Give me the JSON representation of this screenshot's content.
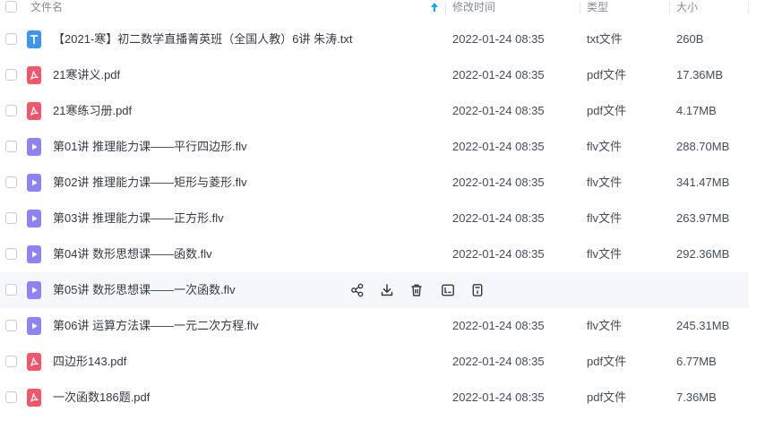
{
  "header": {
    "name_label": "文件名",
    "date_label": "修改时间",
    "type_label": "类型",
    "size_label": "大小"
  },
  "files": [
    {
      "name": "【2021-寒】初二数学直播菁英班（全国人教）6讲 朱涛.txt",
      "icon": "txt-file-icon",
      "date": "2022-01-24 08:35",
      "type": "txt文件",
      "size": "260B"
    },
    {
      "name": "21寒讲义.pdf",
      "icon": "pdf-file-icon",
      "date": "2022-01-24 08:35",
      "type": "pdf文件",
      "size": "17.36MB"
    },
    {
      "name": "21寒练习册.pdf",
      "icon": "pdf-file-icon",
      "date": "2022-01-24 08:35",
      "type": "pdf文件",
      "size": "4.17MB"
    },
    {
      "name": "第01讲 推理能力课——平行四边形.flv",
      "icon": "video-file-icon",
      "date": "2022-01-24 08:35",
      "type": "flv文件",
      "size": "288.70MB"
    },
    {
      "name": "第02讲 推理能力课——矩形与菱形.flv",
      "icon": "video-file-icon",
      "date": "2022-01-24 08:35",
      "type": "flv文件",
      "size": "341.47MB"
    },
    {
      "name": "第03讲 推理能力课——正方形.flv",
      "icon": "video-file-icon",
      "date": "2022-01-24 08:35",
      "type": "flv文件",
      "size": "263.97MB"
    },
    {
      "name": "第04讲 数形思想课——函数.flv",
      "icon": "video-file-icon",
      "date": "2022-01-24 08:35",
      "type": "flv文件",
      "size": "292.36MB"
    },
    {
      "name": "第05讲 数形思想课——一次函数.flv",
      "icon": "video-file-icon",
      "date": "",
      "type": "",
      "size": "",
      "hover": true
    },
    {
      "name": "第06讲 运算方法课——一元二次方程.flv",
      "icon": "video-file-icon",
      "date": "2022-01-24 08:35",
      "type": "flv文件",
      "size": "245.31MB"
    },
    {
      "name": "四边形143.pdf",
      "icon": "pdf-file-icon",
      "date": "2022-01-24 08:35",
      "type": "pdf文件",
      "size": "6.77MB"
    },
    {
      "name": "一次函数186题.pdf",
      "icon": "pdf-file-icon",
      "date": "2022-01-24 08:35",
      "type": "pdf文件",
      "size": "7.36MB"
    }
  ],
  "hover_actions": [
    "share-icon",
    "download-icon",
    "delete-icon",
    "rename-icon",
    "more-info-icon"
  ],
  "colors": {
    "txt_icon": "#3c95f5",
    "pdf_icon": "#f1566b",
    "video_icon": "#8c84f5",
    "sort_arrow": "#06a7ff",
    "hover_row": "#f6f7fa"
  }
}
